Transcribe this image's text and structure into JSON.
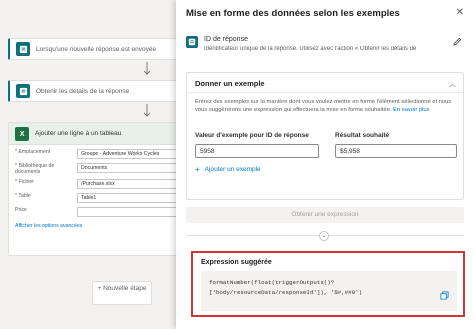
{
  "flow": {
    "step1_label": "Lorsqu'une nouvelle réponse est envoyée",
    "step2_label": "Obtenir les détails de la réponse",
    "excel": {
      "title": "Ajouter une ligne à un tableau",
      "fields": [
        {
          "label": "* Emplacement",
          "value": "Groupe - Adventure Works Cycles"
        },
        {
          "label": "* Bibliothèque de documents",
          "value": "Documents"
        },
        {
          "label": "* Fichier",
          "value": "/Purchase.xlsx"
        },
        {
          "label": "* Table",
          "value": "Table1"
        },
        {
          "label": "Price",
          "value": ""
        }
      ],
      "advanced_link": "Afficher les options avancées"
    },
    "new_step_label": "+ Nouvelle étape"
  },
  "panel": {
    "title": "Mise en forme des données selon les exemples",
    "token": {
      "name": "ID de réponse",
      "description": "Identificateur unique de la réponse. Utilisez avec l'action « Obtenir les détails de"
    },
    "example": {
      "heading": "Donner un exemple",
      "instructions": "Entrez des exemples sur la manière dont vous voulez mettre en forme l'élément sélectionné et nous vous suggérerons une expression qui effectuera la mise en forme souhaitée.",
      "learn_more": "En savoir plus",
      "col1_label": "Valeur d'exemple pour ID de réponse",
      "col2_label": "Résultat souhaité",
      "col1_value": "5958",
      "col2_value": "$5,958",
      "add_example": "Ajouter un exemple"
    },
    "get_expression_button": "Obtenir une expression",
    "suggested": {
      "title": "Expression suggérée",
      "code_line1": "formatNumber(float(triggerOutputs()?",
      "code_line2": "['body/resourceData/responseId']), '$#,##0')"
    }
  },
  "colors": {
    "forms_teal": "#0f6f7d",
    "excel_green": "#1e7145",
    "link_blue": "#0078d4",
    "highlight_red": "#d13438"
  }
}
